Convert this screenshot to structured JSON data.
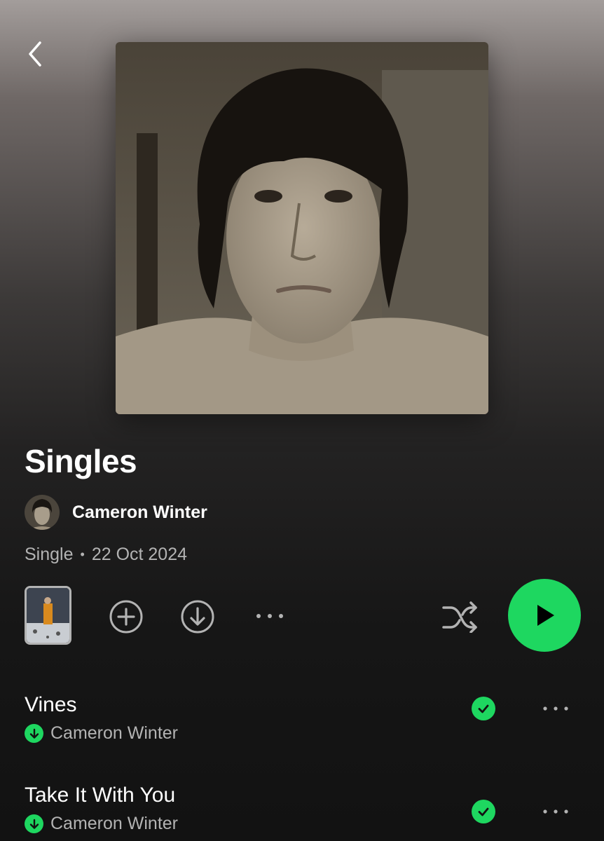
{
  "header": {
    "back_icon": "chevron-left-icon"
  },
  "album": {
    "title": "Singles",
    "artist": "Cameron Winter",
    "type": "Single",
    "separator": "•",
    "date": "22 Oct 2024"
  },
  "actions": {
    "add_icon": "plus-circle-icon",
    "download_icon": "download-circle-icon",
    "more_icon": "more-horizontal-icon",
    "shuffle_icon": "shuffle-icon",
    "play_icon": "play-icon"
  },
  "tracks": [
    {
      "title": "Vines",
      "artist": "Cameron Winter",
      "downloaded": true,
      "saved": true
    },
    {
      "title": "Take It With You",
      "artist": "Cameron Winter",
      "downloaded": true,
      "saved": true
    }
  ],
  "colors": {
    "accent": "#1ed760",
    "secondary_text": "#b3b3b3",
    "background_bottom": "#121212"
  }
}
